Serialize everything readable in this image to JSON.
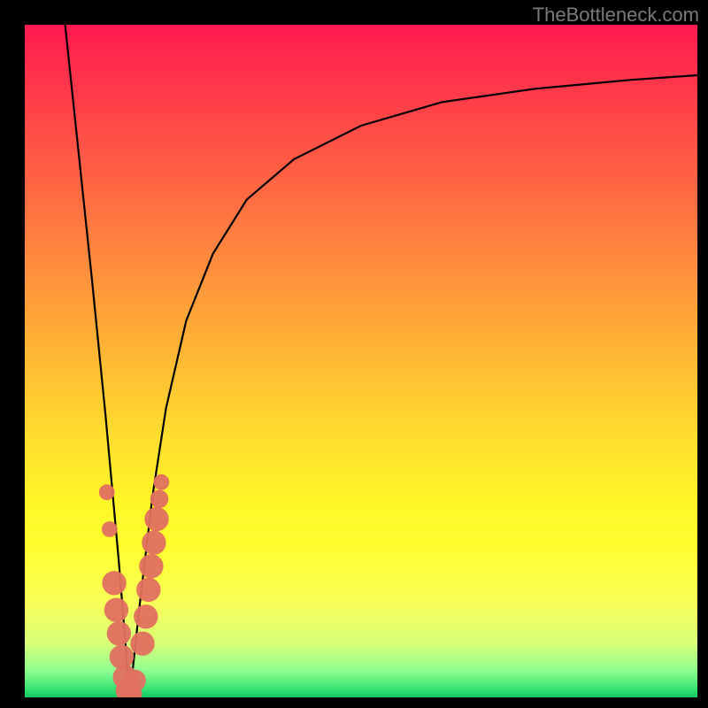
{
  "watermark": "TheBottleneck.com",
  "chart_data": {
    "type": "line",
    "title": "",
    "xlabel": "",
    "ylabel": "",
    "xlim": [
      0,
      100
    ],
    "ylim": [
      0,
      100
    ],
    "minimum_x": 15.6,
    "series": [
      {
        "name": "bottleneck-curve",
        "description": "V-shaped curve descending from top-left to a minimum near x≈15.6 then rising asymptotically toward upper right",
        "x": [
          6,
          8,
          10,
          12,
          14,
          15.6,
          17,
          19,
          21,
          24,
          28,
          33,
          40,
          50,
          62,
          76,
          90,
          100
        ],
        "y": [
          100,
          81,
          62,
          42,
          20,
          0,
          13,
          30,
          43,
          56,
          66,
          74,
          80,
          85,
          88.5,
          90.5,
          91.8,
          92.5
        ]
      }
    ],
    "scatter_markers": {
      "name": "component-points",
      "description": "Salmon-colored rounded markers clustered along both flanks of the V near the minimum",
      "points": [
        {
          "x": 12.2,
          "y": 30.5,
          "r": 1.3
        },
        {
          "x": 12.6,
          "y": 25.0,
          "r": 1.3
        },
        {
          "x": 13.3,
          "y": 17.0,
          "r": 2.0
        },
        {
          "x": 13.6,
          "y": 13.0,
          "r": 2.0
        },
        {
          "x": 14.0,
          "y": 9.5,
          "r": 2.0
        },
        {
          "x": 14.4,
          "y": 6.0,
          "r": 2.0
        },
        {
          "x": 14.9,
          "y": 3.0,
          "r": 2.0
        },
        {
          "x": 15.3,
          "y": 1.0,
          "r": 2.0
        },
        {
          "x": 15.8,
          "y": 0.5,
          "r": 1.8
        },
        {
          "x": 16.4,
          "y": 2.5,
          "r": 1.8
        },
        {
          "x": 17.5,
          "y": 8.0,
          "r": 2.0
        },
        {
          "x": 18.0,
          "y": 12.0,
          "r": 2.0
        },
        {
          "x": 18.4,
          "y": 16.0,
          "r": 2.0
        },
        {
          "x": 18.8,
          "y": 19.5,
          "r": 2.0
        },
        {
          "x": 19.2,
          "y": 23.0,
          "r": 2.0
        },
        {
          "x": 19.6,
          "y": 26.5,
          "r": 2.0
        },
        {
          "x": 20.0,
          "y": 29.5,
          "r": 1.5
        },
        {
          "x": 20.3,
          "y": 32.0,
          "r": 1.3
        }
      ]
    }
  }
}
